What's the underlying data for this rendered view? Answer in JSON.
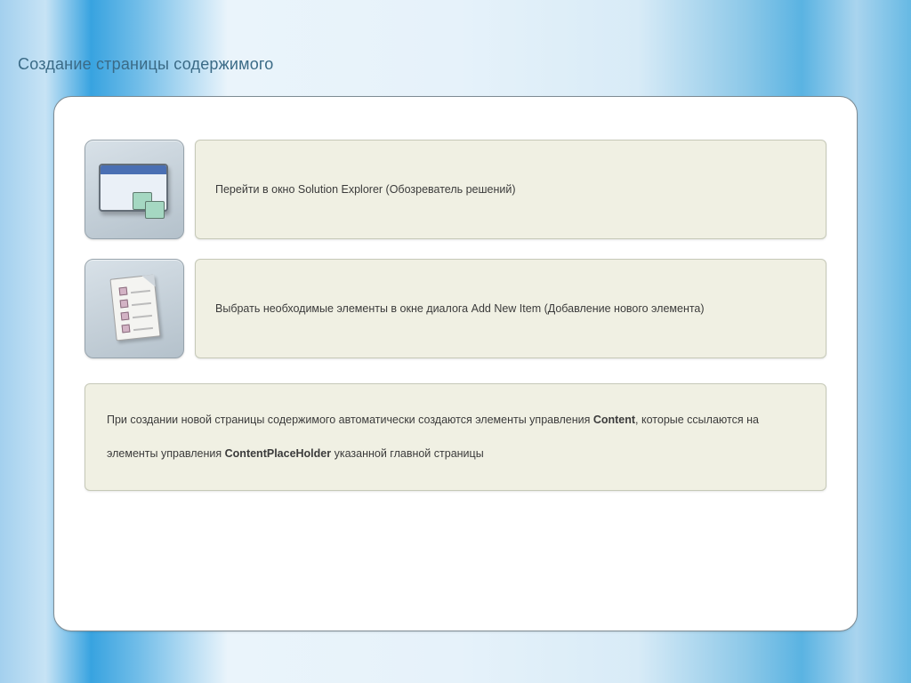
{
  "title": "Создание страницы содержимого",
  "steps": [
    {
      "text": "Перейти в окно Solution Explorer (Обозреватель решений)"
    },
    {
      "text": "Выбрать необходимые элементы в окне диалога Add New Item (Добавление нового элемента)"
    }
  ],
  "note": {
    "pre": "При создании новой страницы содержимого автоматически создаются элементы управления ",
    "bold1": "Content",
    "mid": ", которые ссылаются на элементы управления  ",
    "bold2": "ContentPlaceHolder",
    "post": " указанной главной страницы"
  }
}
